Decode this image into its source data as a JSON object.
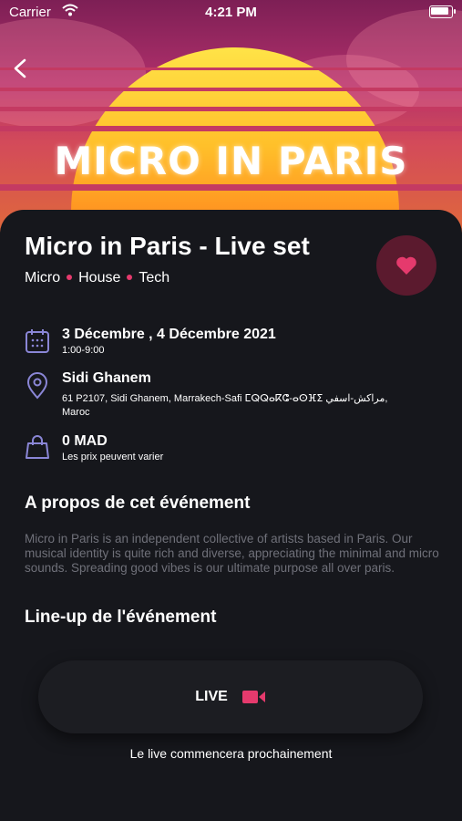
{
  "status_bar": {
    "carrier": "Carrier",
    "time": "4:21 PM"
  },
  "hero": {
    "title": "MICRO IN PARIS"
  },
  "event": {
    "title": "Micro in Paris - Live set",
    "tags": [
      "Micro",
      "House",
      "Tech"
    ]
  },
  "details": {
    "date": {
      "main": "3 Décembre , 4 Décembre 2021",
      "sub": "1:00-9:00"
    },
    "location": {
      "main": "Sidi Ghanem",
      "sub1": "61 P2107, Sidi Ghanem, Marrakech-Safi ⵎⵕⵕⴰⴽⵛ-ⴰⵙⴼⵉ مراكش-اسفي,",
      "sub2": "Maroc"
    },
    "price": {
      "main": "0 MAD",
      "sub": "Les prix peuvent varier"
    }
  },
  "about": {
    "heading": "A propos de cet événement",
    "text": "Micro in Paris is an independent collective of artists based in Paris. Our musical identity is quite rich and diverse, appreciating the minimal and micro sounds. Spreading good vibes is our ultimate purpose all over paris."
  },
  "lineup": {
    "heading": "Line-up de l'événement"
  },
  "live": {
    "label": "LIVE",
    "note": "Le live commencera prochainement"
  },
  "colors": {
    "accent": "#e53a6d",
    "background": "#16171c",
    "icon_outline": "#8a86d6"
  },
  "icons": [
    "wifi-icon",
    "battery-icon",
    "back-chevron-icon",
    "heart-icon",
    "calendar-icon",
    "location-pin-icon",
    "shopping-bag-icon",
    "video-camera-icon"
  ]
}
